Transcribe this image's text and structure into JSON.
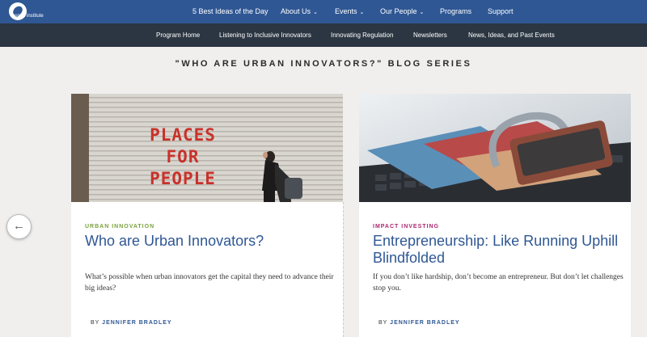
{
  "logo": {
    "text": "aspen institute",
    "icon": "aspen-leaf-logo"
  },
  "topnav": {
    "items": [
      {
        "label": "5 Best Ideas of the Day",
        "has_dropdown": false
      },
      {
        "label": "About Us",
        "has_dropdown": true
      },
      {
        "label": "Events",
        "has_dropdown": true
      },
      {
        "label": "Our People",
        "has_dropdown": true
      },
      {
        "label": "Programs",
        "has_dropdown": false
      },
      {
        "label": "Support",
        "has_dropdown": false
      }
    ]
  },
  "subnav": {
    "items": [
      {
        "label": "Program Home"
      },
      {
        "label": "Listening to Inclusive Innovators"
      },
      {
        "label": "Innovating Regulation"
      },
      {
        "label": "Newsletters"
      },
      {
        "label": "News, Ideas, and Past Events"
      }
    ]
  },
  "series_title": "\"WHO ARE URBAN INNOVATORS?\" BLOG SERIES",
  "cards": [
    {
      "category": "URBAN INNOVATION",
      "category_color": "#7ba23a",
      "title": "Who are Urban Innovators?",
      "description": "What’s possible when urban innovators get the capital they need to advance their big ideas?",
      "by_prefix": "BY",
      "author": "JENNIFER BRADLEY",
      "image_text": [
        "PLACES",
        "FOR",
        "PEOPLE"
      ]
    },
    {
      "category": "IMPACT INVESTING",
      "category_color": "#b0256e",
      "title": "Entrepreneurship: Like Running Uphill Blindfolded",
      "description": "If you don’t like hardship, don’t become an entrepreneur. But don’t let challenges stop you.",
      "by_prefix": "BY",
      "author": "JENNIFER BRADLEY"
    }
  ],
  "carousel": {
    "prev_icon": "arrow-left-icon",
    "prev_glyph": "←"
  },
  "colors": {
    "nav_blue": "#2f5794",
    "subnav_dark": "#2b3642",
    "title_blue": "#2f5794"
  }
}
